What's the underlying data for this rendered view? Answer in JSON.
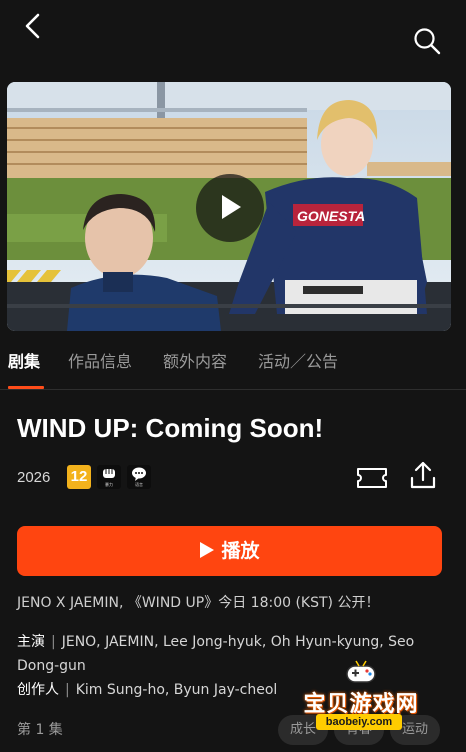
{
  "header": {
    "back_icon": "chevron-left-icon",
    "search_icon": "search-icon"
  },
  "hero": {
    "play_icon": "play-icon",
    "jersey_text": "GONESTA"
  },
  "tabs": [
    {
      "label": "剧集",
      "active": true
    },
    {
      "label": "作品信息",
      "active": false
    },
    {
      "label": "额外内容",
      "active": false
    },
    {
      "label": "活动／公告",
      "active": false
    }
  ],
  "show": {
    "title": "WIND UP: Coming Soon!",
    "year": "2026",
    "age_rating": "12",
    "content_badges": [
      "暴力",
      "语言"
    ],
    "ticket_icon": "ticket-icon",
    "share_icon": "share-icon"
  },
  "play_button": {
    "label": "播放",
    "color": "#ff4510"
  },
  "description": "JENO X JAEMIN, 《WIND UP》今日 18:00 (KST) 公开！",
  "credits": {
    "cast_label": "主演",
    "cast": "JENO, JAEMIN, Lee Jong-hyuk, Oh Hyun-kyung, Seo Dong-gun",
    "creator_label": "创作人",
    "creators": "Kim Sung-ho, Byun Jay-cheol"
  },
  "episodes": {
    "current": "第 1 集"
  },
  "genre_chips": [
    "成长",
    "青春",
    "运动"
  ],
  "watermark": {
    "title": "宝贝游戏网",
    "url": "baobeiy.com"
  },
  "colors": {
    "accent": "#ff4510",
    "background": "#141414",
    "age_badge": "#f3b21c"
  }
}
